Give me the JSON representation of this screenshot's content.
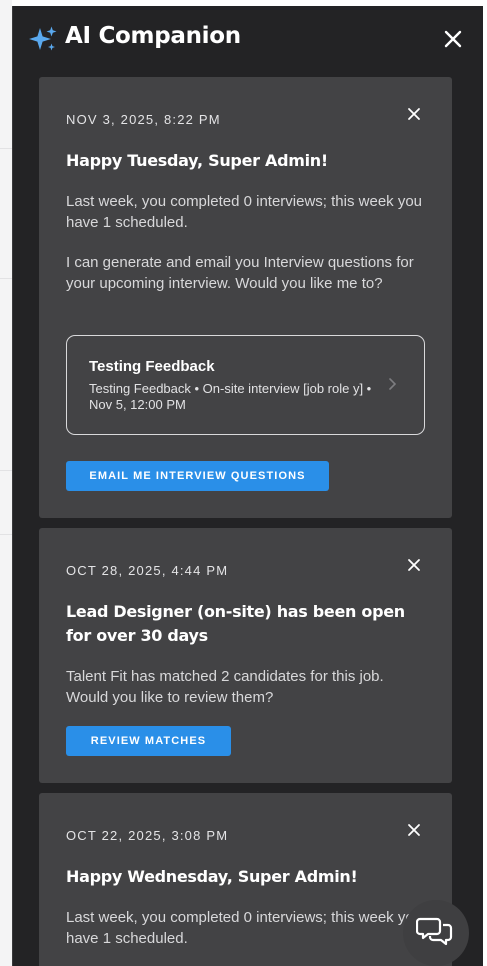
{
  "panel": {
    "title": "AI Companion",
    "icon": "sparkle-icon",
    "close_icon": "close-icon"
  },
  "cards": [
    {
      "date": "NOV 3, 2025, 8:22 PM",
      "heading": "Happy Tuesday, Super Admin!",
      "paragraphs": [
        "Last week, you completed 0 interviews; this week you have 1 scheduled.",
        "I can generate and email you Interview questions for your upcoming interview. Would you like me to?"
      ],
      "interview": {
        "title": "Testing Feedback",
        "subtitle": "Testing Feedback • On-site interview [job role y] • Nov 5, 12:00 PM"
      },
      "button_label": "EMAIL ME INTERVIEW QUESTIONS"
    },
    {
      "date": "OCT 28, 2025, 4:44 PM",
      "heading": "Lead Designer (on-site) has been open for over 30 days",
      "paragraphs": [
        "Talent Fit has matched 2 candidates for this job. Would you like to review them?"
      ],
      "button_label": "REVIEW MATCHES"
    },
    {
      "date": "OCT 22, 2025, 3:08 PM",
      "heading": "Happy Wednesday, Super Admin!",
      "paragraphs": [
        "Last week, you completed 0 interviews; this week you have 1 scheduled."
      ]
    }
  ],
  "chat_button": {
    "icon": "chat-bubbles-icon"
  },
  "colors": {
    "panel_bg": "#232325",
    "card_bg": "#434345",
    "accent": "#2a8fe8",
    "sparkle": "#5aa9ef"
  }
}
